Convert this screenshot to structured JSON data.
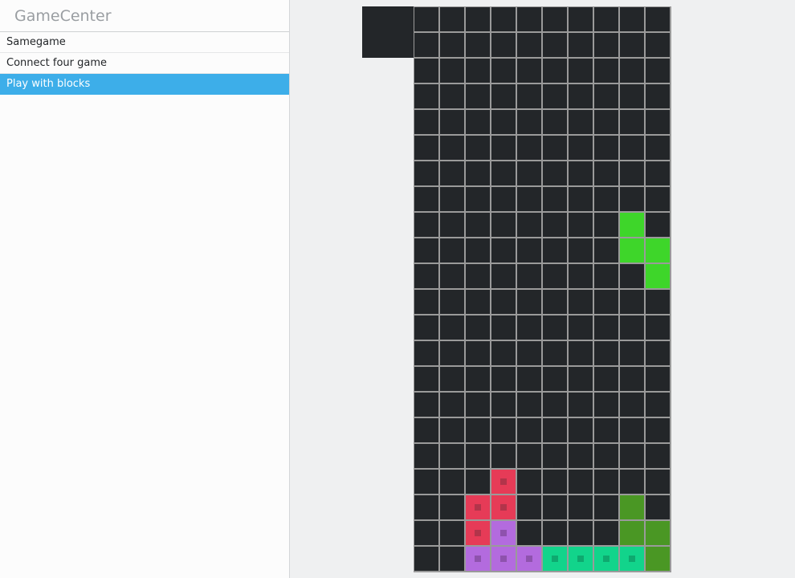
{
  "app": {
    "title": "GameCenter"
  },
  "menu": {
    "items": [
      {
        "id": "samegame",
        "label": "Samegame",
        "selected": false
      },
      {
        "id": "connect-four",
        "label": "Connect four game",
        "selected": false
      },
      {
        "id": "play-with-blocks",
        "label": "Play with blocks",
        "selected": true
      }
    ]
  },
  "board": {
    "cols": 10,
    "rows": 22,
    "empty_color": "#232629",
    "grid_color": "#9a9a9a",
    "colors": {
      "G": "#3ed62a",
      "g": "#4a9724",
      "R": "#e63b57",
      "P": "#b36bde",
      "T": "#12d48b"
    },
    "dot_colors": {
      "R": "#b2344a",
      "P": "#8e52ad",
      "T": "#0ea96f"
    },
    "grid": [
      "..........",
      "..........",
      "..........",
      "..........",
      "..........",
      "..........",
      "..........",
      "..........",
      "........G.",
      "........GG",
      ".........G",
      "..........",
      "..........",
      "..........",
      "..........",
      "..........",
      "..........",
      "..........",
      "...R......",
      "..RR....g.",
      "..RP....gg",
      "..PPPTTTTg"
    ]
  }
}
